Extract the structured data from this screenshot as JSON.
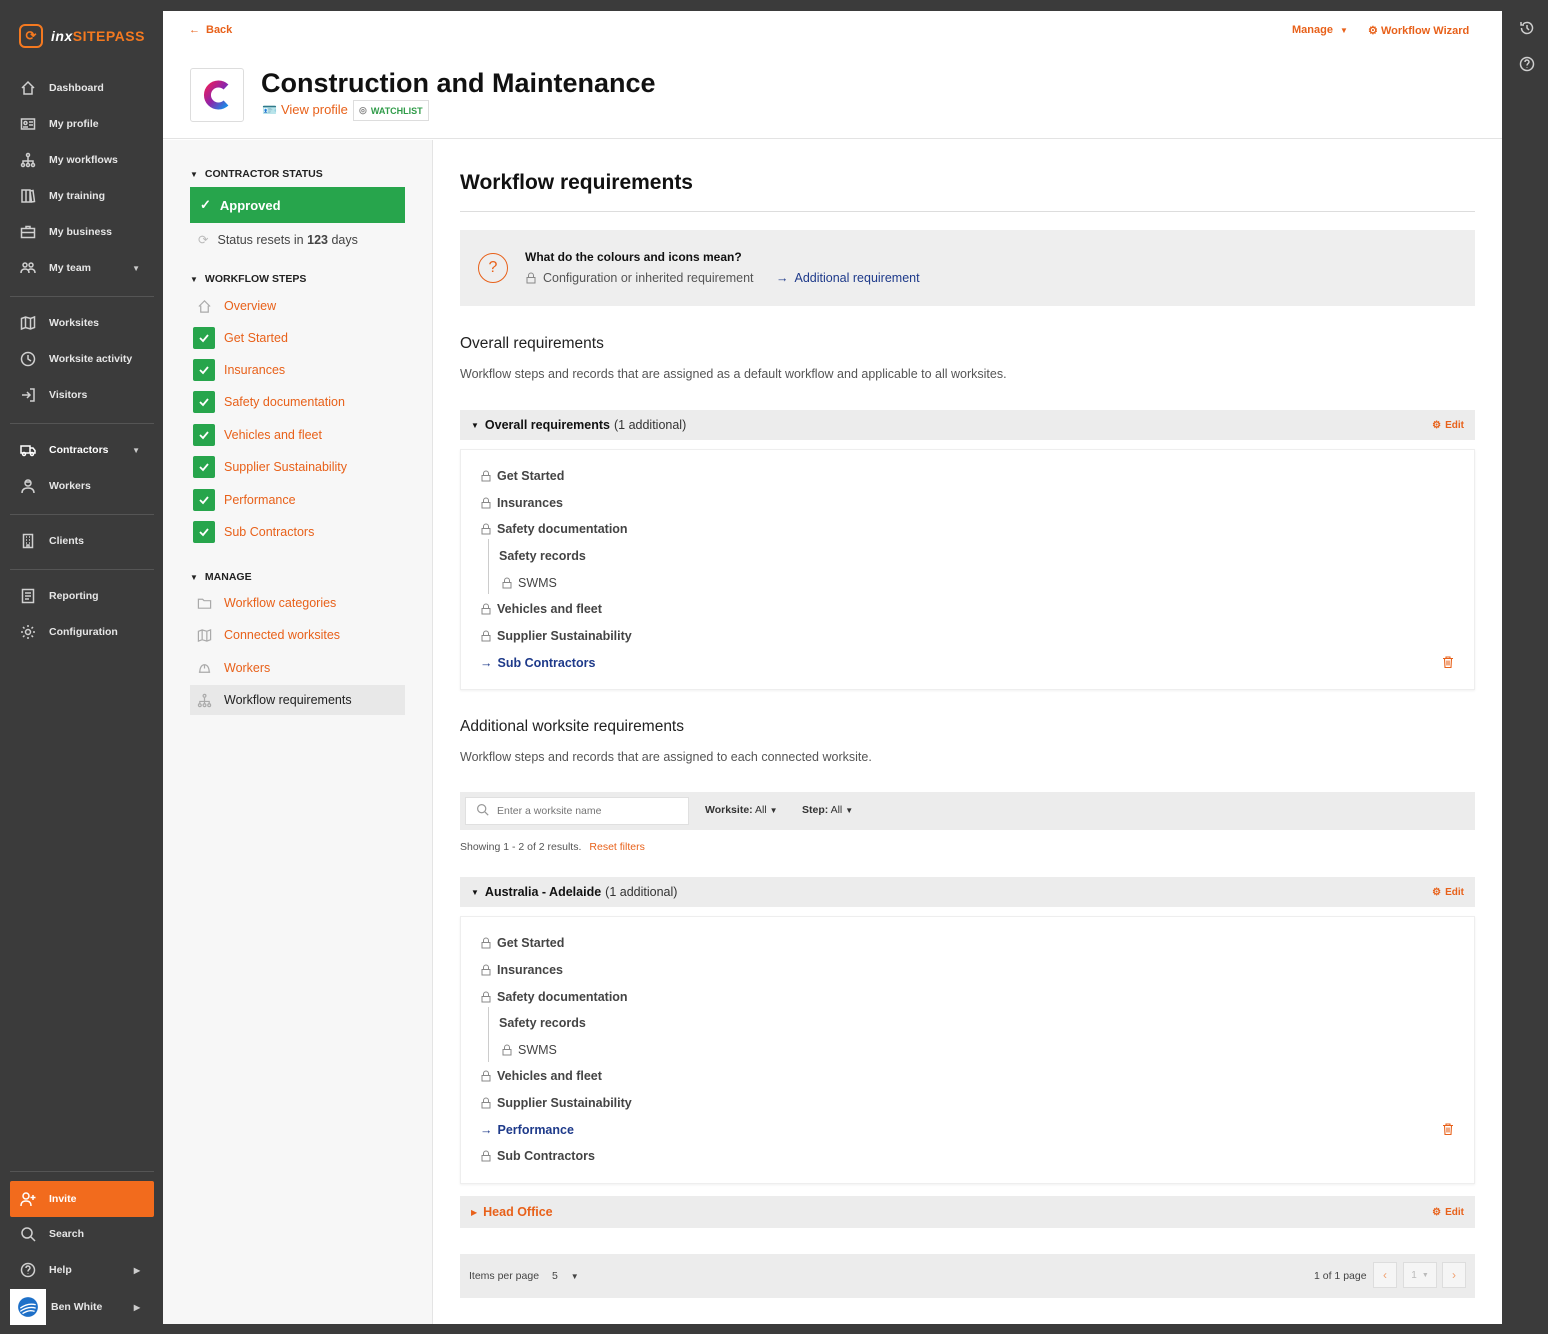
{
  "brand": {
    "mark": "⟳",
    "name_part1": "inx",
    "name_part2": "SITEPASS"
  },
  "sidebar": {
    "items": [
      {
        "label": "Dashboard",
        "icon": "home-icon"
      },
      {
        "label": "My profile",
        "icon": "id-card-icon"
      },
      {
        "label": "My workflows",
        "icon": "workflow-icon"
      },
      {
        "label": "My training",
        "icon": "book-icon"
      },
      {
        "label": "My business",
        "icon": "briefcase-icon"
      },
      {
        "label": "My team",
        "icon": "team-icon"
      },
      {
        "label": "Worksites",
        "icon": "map-icon"
      },
      {
        "label": "Worksite activity",
        "icon": "clock-icon"
      },
      {
        "label": "Visitors",
        "icon": "sign-in-icon"
      },
      {
        "label": "Contractors",
        "icon": "truck-icon"
      },
      {
        "label": "Workers",
        "icon": "worker-icon"
      },
      {
        "label": "Clients",
        "icon": "building-icon"
      },
      {
        "label": "Reporting",
        "icon": "report-icon"
      },
      {
        "label": "Configuration",
        "icon": "gear-icon"
      }
    ],
    "invite": "Invite",
    "search": "Search",
    "help": "Help",
    "user": "Ben White"
  },
  "header": {
    "back": "Back",
    "manage": "Manage",
    "wizard": "Workflow Wizard",
    "company": "Construction and Maintenance",
    "view_profile": "View profile",
    "watchlist": "WATCHLIST"
  },
  "left": {
    "status_title": "CONTRACTOR STATUS",
    "status": "Approved",
    "resets_prefix": "Status resets in",
    "resets_days": "123",
    "resets_suffix": "days",
    "steps_title": "WORKFLOW STEPS",
    "overview": "Overview",
    "steps": [
      "Get Started",
      "Insurances",
      "Safety documentation",
      "Vehicles and fleet",
      "Supplier Sustainability",
      "Performance",
      "Sub Contractors"
    ],
    "manage_title": "MANAGE",
    "manage_items": [
      "Workflow categories",
      "Connected worksites",
      "Workers",
      "Workflow requirements"
    ]
  },
  "content": {
    "title": "Workflow requirements",
    "legend_title": "What do the colours and icons mean?",
    "legend_config": "Configuration or inherited requirement",
    "legend_additional": "Additional requirement",
    "overall_h": "Overall requirements",
    "overall_p": "Workflow steps and records that are assigned as a default workflow and applicable to all worksites.",
    "overall_acc": {
      "name": "Overall requirements",
      "extra": "(1 additional)",
      "edit": "Edit"
    },
    "overall_items": {
      "get_started": "Get Started",
      "insurances": "Insurances",
      "safety_doc": "Safety documentation",
      "safety_records": "Safety records",
      "swms": "SWMS",
      "vehicles": "Vehicles and fleet",
      "supplier": "Supplier Sustainability",
      "sub": "Sub Contractors"
    },
    "additional_h": "Additional worksite requirements",
    "additional_p": "Workflow steps and records that are assigned to each connected worksite.",
    "search_placeholder": "Enter a worksite name",
    "filter_worksite_label": "Worksite:",
    "filter_worksite_value": "All",
    "filter_step_label": "Step:",
    "filter_step_value": "All",
    "showing": "Showing 1 - 2 of 2 results.",
    "reset_filters": "Reset filters",
    "adelaide_acc": {
      "name": "Australia - Adelaide",
      "extra": "(1 additional)",
      "edit": "Edit"
    },
    "adelaide_items": {
      "get_started": "Get Started",
      "insurances": "Insurances",
      "safety_doc": "Safety documentation",
      "safety_records": "Safety records",
      "swms": "SWMS",
      "vehicles": "Vehicles and fleet",
      "supplier": "Supplier Sustainability",
      "performance": "Performance",
      "sub": "Sub Contractors"
    },
    "head_office_acc": {
      "name": "Head Office",
      "edit": "Edit"
    },
    "pager": {
      "items_label": "Items per page",
      "per_page": "5",
      "page_info": "1 of 1 page",
      "page": "1"
    }
  },
  "colors": {
    "accent": "#e8611a",
    "success": "#27a54c",
    "link_blue": "#1e3a8a",
    "sidebar": "#3b3b3b"
  }
}
